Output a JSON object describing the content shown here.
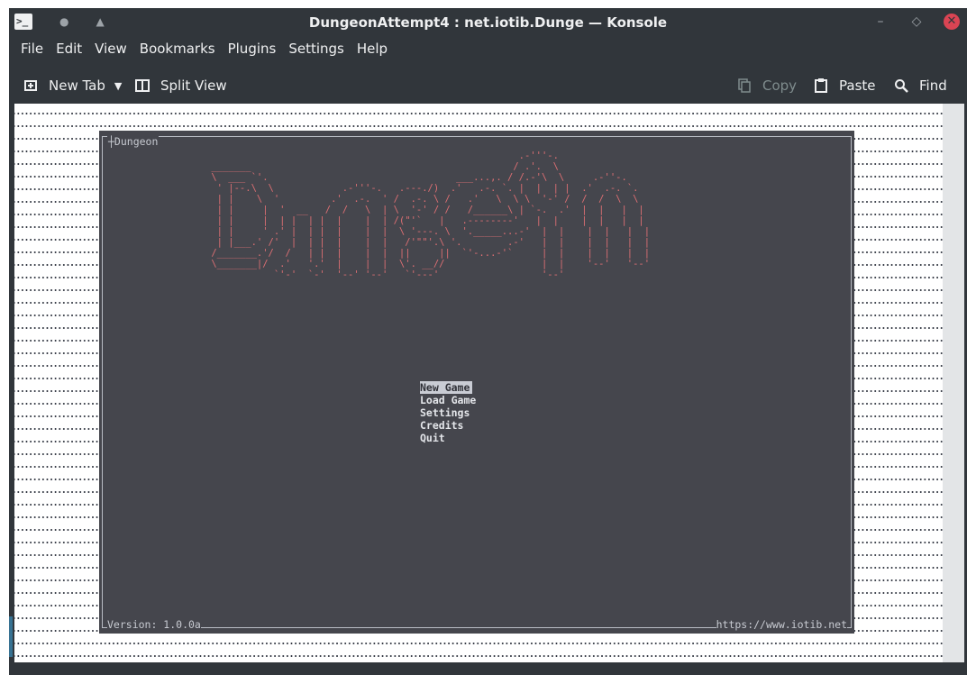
{
  "window": {
    "title": "DungeonAttempt4 : net.iotib.Dunge — Konsole",
    "app_icon_glyph": ">_",
    "buttons": {
      "keep_above": "●",
      "shade": "▲",
      "minimize": "–",
      "maximize": "◇",
      "close": "✕"
    }
  },
  "menubar": [
    "File",
    "Edit",
    "View",
    "Bookmarks",
    "Plugins",
    "Settings",
    "Help"
  ],
  "toolbar": {
    "new_tab": "New Tab",
    "split_view": "Split View",
    "copy": "Copy",
    "paste": "Paste",
    "find": "Find"
  },
  "terminal": {
    "panel_title": "┼Dungeon",
    "version": "Version: 1.0.0a",
    "url": "https://www.iotib.net",
    "menu": [
      {
        "label": "New Game",
        "selected": true
      },
      {
        "label": "Load Game",
        "selected": false
      },
      {
        "label": "Settings",
        "selected": false
      },
      {
        "label": "Credits",
        "selected": false
      },
      {
        "label": "Quit",
        "selected": false
      }
    ]
  },
  "colors": {
    "window_bg": "#31363b",
    "terminal_panel": "#45464d",
    "logo": "#dc6f73",
    "close": "#da4453"
  }
}
